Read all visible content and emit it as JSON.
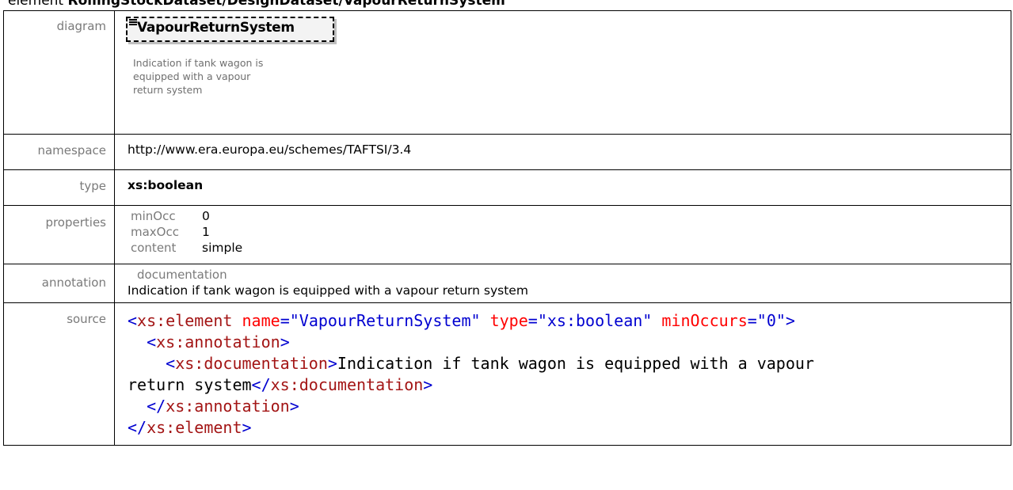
{
  "heading": {
    "prefix": "element ",
    "path": "RollingStockDataset/DesignDataset/VapourReturnSystem"
  },
  "rows": {
    "diagram": {
      "label": "diagram",
      "element_name": "VapourReturnSystem",
      "documentation_lines": [
        "Indication if tank wagon is",
        "equipped with a vapour",
        "return system"
      ]
    },
    "namespace": {
      "label": "namespace",
      "value": "http://www.era.europa.eu/schemes/TAFTSI/3.4"
    },
    "type": {
      "label": "type",
      "value": "xs:boolean"
    },
    "properties": {
      "label": "properties",
      "items": [
        {
          "key": "minOcc",
          "value": "0"
        },
        {
          "key": "maxOcc",
          "value": "1"
        },
        {
          "key": "content",
          "value": "simple"
        }
      ]
    },
    "annotation": {
      "label": "annotation",
      "key": "documentation",
      "value": "Indication if tank wagon is equipped with a vapour return system"
    },
    "source": {
      "label": "source",
      "lines": [
        {
          "t1": "<",
          "t2": "xs:element",
          "a1": " name",
          "eq1": "=",
          "v1": "\"VapourReturnSystem\"",
          "a2": " type",
          "eq2": "=",
          "v2": "\"xs:boolean\"",
          "a3": " minOccurs",
          "eq3": "=",
          "v3": "\"0\"",
          "t3": ">"
        },
        {
          "indent": "  ",
          "open": "<",
          "name": "xs:annotation",
          "close": ">"
        },
        {
          "indent": "    ",
          "open": "<",
          "name": "xs:documentation",
          "close": ">",
          "text": "Indication if tank wagon is equipped with a vapour"
        },
        {
          "text": "return system",
          "open": "</",
          "name": "xs:documentation",
          "close": ">"
        },
        {
          "indent": "  ",
          "open": "</",
          "name": "xs:annotation",
          "close": ">"
        },
        {
          "open": "</",
          "name": "xs:element",
          "close": ">"
        }
      ]
    }
  },
  "colors": {
    "label_gray": "#7a7a7a",
    "xml_bracket": "#0000d0",
    "xml_tag_name": "#a31515",
    "xml_attr_name": "#ff0000",
    "xml_attr_value": "#0000d0"
  }
}
